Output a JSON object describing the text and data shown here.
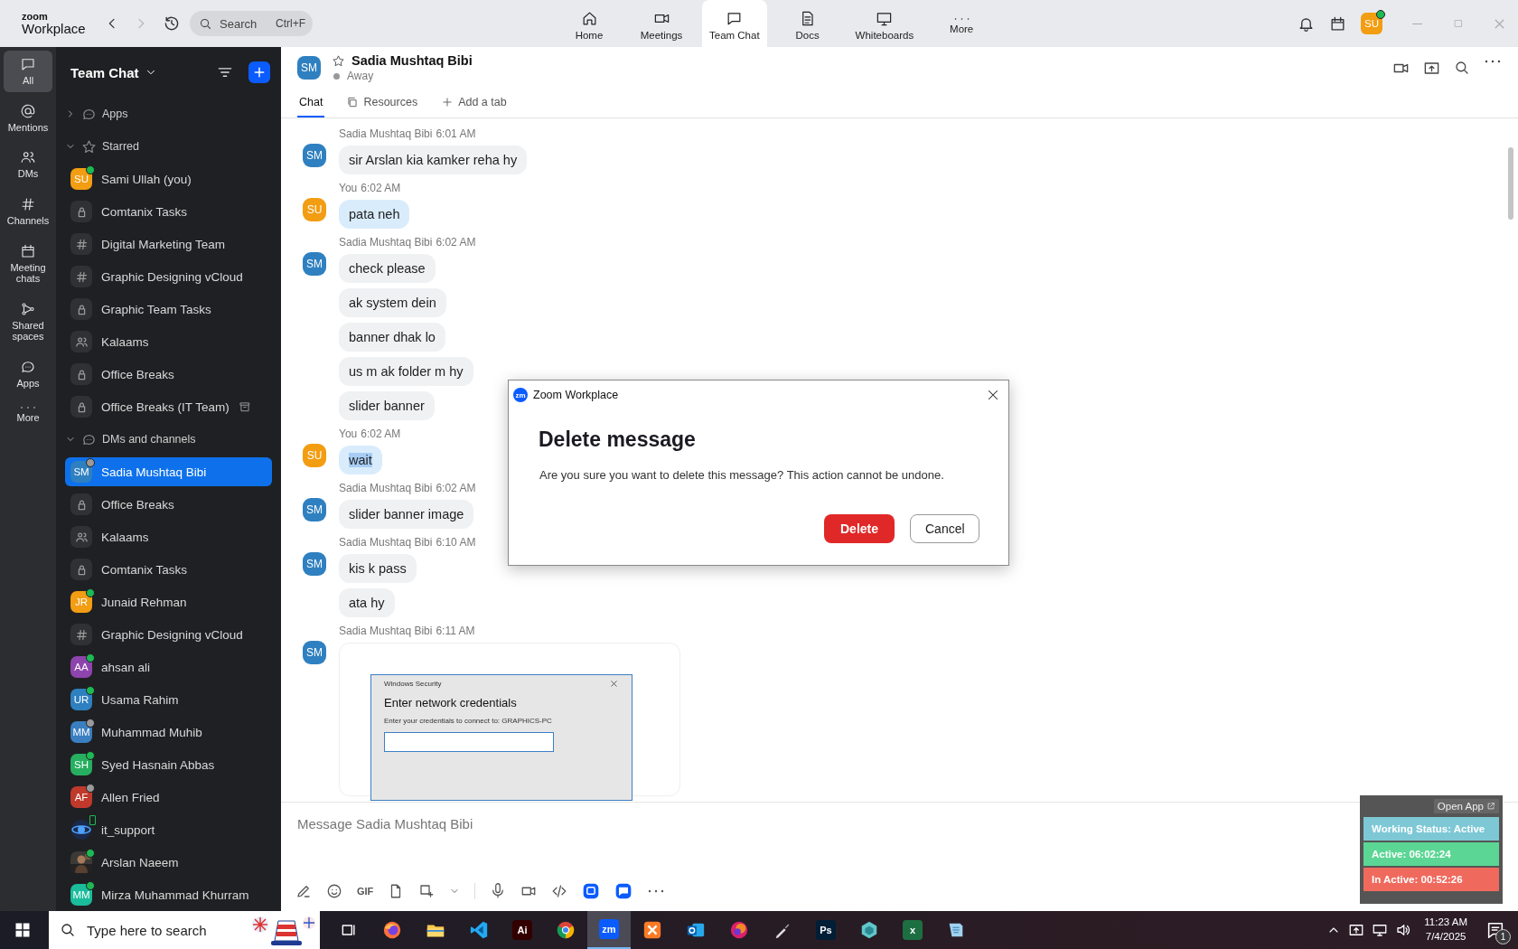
{
  "topbar": {
    "logo_top": "zoom",
    "logo_bottom": "Workplace",
    "history": [
      {
        "kind": "back",
        "disabled": false
      },
      {
        "kind": "forward",
        "disabled": true
      }
    ],
    "search": {
      "placeholder": "Search",
      "shortcut": "Ctrl+F"
    },
    "nav": [
      {
        "label": "Home",
        "selected": false
      },
      {
        "label": "Meetings",
        "selected": false
      },
      {
        "label": "Team Chat",
        "selected": true
      },
      {
        "label": "Docs",
        "selected": false
      },
      {
        "label": "Whiteboards",
        "selected": false
      },
      {
        "label": "More",
        "selected": false
      }
    ],
    "user": {
      "initials": "SU",
      "color": "#f29d12",
      "online": true
    }
  },
  "rail": [
    {
      "label": "All",
      "selected": true
    },
    {
      "label": "Mentions",
      "selected": false
    },
    {
      "label": "DMs",
      "selected": false
    },
    {
      "label": "Channels",
      "selected": false
    },
    {
      "label": "Meeting chats",
      "selected": false
    },
    {
      "label": "Shared spaces",
      "selected": false
    },
    {
      "label": "Apps",
      "selected": false
    },
    {
      "label": "More",
      "selected": false
    }
  ],
  "sidebar": {
    "title": "Team Chat",
    "sections": [
      {
        "label": "Apps",
        "expanded": false
      },
      {
        "label": "Starred",
        "expanded": true,
        "items": [
          {
            "label": "Sami Ullah (you)",
            "kind": "avatar",
            "initials": "SU",
            "color": "#f29d12",
            "online": true,
            "archived": false,
            "selected": false
          },
          {
            "label": "Comtanix Tasks",
            "kind": "lock",
            "archived": false,
            "selected": false
          },
          {
            "label": "Digital Marketing Team",
            "kind": "hash",
            "archived": false,
            "selected": false
          },
          {
            "label": "Graphic Designing vCloud",
            "kind": "hash",
            "archived": false,
            "selected": false
          },
          {
            "label": "Graphic Team Tasks",
            "kind": "lock",
            "archived": false,
            "selected": false
          },
          {
            "label": "Kalaams",
            "kind": "group",
            "archived": false,
            "selected": false
          },
          {
            "label": "Office Breaks",
            "kind": "lock",
            "archived": false,
            "selected": false
          },
          {
            "label": "Office Breaks (IT Team)",
            "kind": "lock",
            "archived": true,
            "selected": false
          }
        ]
      },
      {
        "label": "DMs and channels",
        "expanded": true,
        "items": [
          {
            "label": "Sadia Mushtaq Bibi",
            "kind": "avatar",
            "initials": "SM",
            "color": "#2f80c0",
            "online": false,
            "archived": false,
            "selected": true
          },
          {
            "label": "Office Breaks",
            "kind": "lock",
            "archived": false,
            "selected": false
          },
          {
            "label": "Kalaams",
            "kind": "group",
            "archived": false,
            "selected": false
          },
          {
            "label": "Comtanix Tasks",
            "kind": "lock",
            "archived": false,
            "selected": false
          },
          {
            "label": "Junaid Rehman",
            "kind": "avatar",
            "initials": "JR",
            "color": "#f29d12",
            "online": true,
            "archived": false,
            "selected": false
          },
          {
            "label": "Graphic Designing vCloud",
            "kind": "hash",
            "archived": false,
            "selected": false
          },
          {
            "label": "ahsan ali",
            "kind": "avatar",
            "initials": "AA",
            "color": "#8e44ad",
            "online": true,
            "archived": false,
            "selected": false
          },
          {
            "label": "Usama Rahim",
            "kind": "avatar",
            "initials": "UR",
            "color": "#2f80c0",
            "online": true,
            "archived": false,
            "selected": false
          },
          {
            "label": "Muhammad Muhib",
            "kind": "avatar",
            "initials": "MM",
            "color": "#3a7fc0",
            "online": false,
            "archived": false,
            "selected": false
          },
          {
            "label": "Syed Hasnain Abbas",
            "kind": "avatar",
            "initials": "SH",
            "color": "#27ae60",
            "online": true,
            "archived": false,
            "selected": false
          },
          {
            "label": "Allen Fried",
            "kind": "avatar",
            "initials": "AF",
            "color": "#c0392b",
            "online": false,
            "archived": false,
            "selected": false
          },
          {
            "label": "it_support",
            "kind": "logo",
            "online": true,
            "archived": false,
            "selected": false
          },
          {
            "label": "Arslan Naeem",
            "online": true,
            "archived": false,
            "selected": false
          },
          {
            "label": "Mirza Muhammad Khurram",
            "kind": "avatar",
            "initials": "MM",
            "color": "#1abc9c",
            "online": true,
            "archived": false,
            "selected": false
          }
        ]
      }
    ]
  },
  "chat": {
    "contact": {
      "name": "Sadia Mushtaq Bibi",
      "initials": "SM",
      "color": "#2f80c0",
      "status": "Away",
      "starred": false
    },
    "tabs": [
      {
        "label": "Chat",
        "selected": true
      },
      {
        "label": "Resources",
        "selected": false
      },
      {
        "label": "Add a tab",
        "selected": false
      }
    ],
    "messages": [
      {
        "sender": "Sadia Mushtaq Bibi",
        "time": "6:01 AM",
        "initials": "SM",
        "color": "#2f80c0",
        "mine": false,
        "bubbles": [
          {
            "text": "sir Arslan kia kamker reha hy",
            "highlighted": false
          }
        ]
      },
      {
        "sender": "You",
        "time": "6:02 AM",
        "initials": "SU",
        "color": "#f29d12",
        "mine": true,
        "bubbles": [
          {
            "text": "pata neh",
            "highlighted": false
          }
        ]
      },
      {
        "sender": "Sadia Mushtaq Bibi",
        "time": "6:02 AM",
        "initials": "SM",
        "color": "#2f80c0",
        "mine": false,
        "bubbles": [
          {
            "text": "check please",
            "highlighted": false
          },
          {
            "text": "ak system dein",
            "highlighted": false
          },
          {
            "text": "banner dhak lo",
            "highlighted": false
          },
          {
            "text": "us m ak folder m hy",
            "highlighted": false
          },
          {
            "text": "slider banner",
            "highlighted": false
          }
        ]
      },
      {
        "sender": "You",
        "time": "6:02 AM",
        "initials": "SU",
        "color": "#f29d12",
        "mine": true,
        "bubbles": [
          {
            "text": "wait",
            "highlighted": true
          }
        ]
      },
      {
        "sender": "Sadia Mushtaq Bibi",
        "time": "6:02 AM",
        "initials": "SM",
        "color": "#2f80c0",
        "mine": false,
        "bubbles": [
          {
            "text": "slider banner image",
            "highlighted": false
          }
        ]
      },
      {
        "sender": "Sadia Mushtaq Bibi",
        "time": "6:10 AM",
        "initials": "SM",
        "color": "#2f80c0",
        "mine": false,
        "bubbles": [
          {
            "text": "kis k pass",
            "highlighted": false
          },
          {
            "text": "ata hy",
            "highlighted": false
          }
        ]
      },
      {
        "sender": "Sadia Mushtaq Bibi",
        "time": "6:11 AM",
        "initials": "SM",
        "color": "#2f80c0",
        "mine": false,
        "attachment": {
          "kind": "screenshot",
          "window_title": "Windows Security",
          "heading": "Enter network credentials",
          "text": "Enter your credentials to connect to: GRAPHICS-PC"
        }
      }
    ],
    "composer": {
      "placeholder": "Message Sadia Mushtaq Bibi",
      "gif": "GIF"
    }
  },
  "dialog": {
    "app": "Zoom Workplace",
    "app_logo": "zm",
    "title": "Delete message",
    "body": "Are you sure you want to delete this message? This action cannot be undone.",
    "buttons": [
      {
        "label": "Delete",
        "kind": "danger"
      },
      {
        "label": "Cancel",
        "kind": "secondary"
      }
    ]
  },
  "status_widget": {
    "link": "Open App",
    "rows": [
      {
        "label": "Working Status: Active",
        "color": "#7ec8d6"
      },
      {
        "label": "Active: 06:02:24",
        "color": "#5cd694"
      },
      {
        "label": "In Active: 00:52:26",
        "color": "#ef6a5d"
      }
    ]
  },
  "taskbar": {
    "search_placeholder": "Type here to search",
    "apps": [
      {
        "kind": "taskview",
        "active": false
      },
      {
        "kind": "firefox",
        "active": false
      },
      {
        "kind": "folder",
        "active": false
      },
      {
        "kind": "vscode",
        "active": false
      },
      {
        "kind": "tile",
        "label": "Ai",
        "color": "#330000",
        "active": false
      },
      {
        "kind": "chrome",
        "active": false
      },
      {
        "kind": "tile",
        "label": "zm",
        "color": "#0b5cff",
        "active": true
      },
      {
        "kind": "xampp",
        "active": false
      },
      {
        "kind": "outlook",
        "active": false
      },
      {
        "kind": "cloud",
        "active": false
      },
      {
        "kind": "brush",
        "active": false
      },
      {
        "kind": "tile",
        "label": "Ps",
        "color": "#001e36",
        "active": false
      },
      {
        "kind": "gem",
        "active": false
      },
      {
        "kind": "tile",
        "label": "x",
        "color": "#1d6f42",
        "active": false
      },
      {
        "kind": "notes",
        "active": false
      }
    ],
    "time": "11:23 AM",
    "date": "7/4/2025",
    "notifications": "1"
  }
}
